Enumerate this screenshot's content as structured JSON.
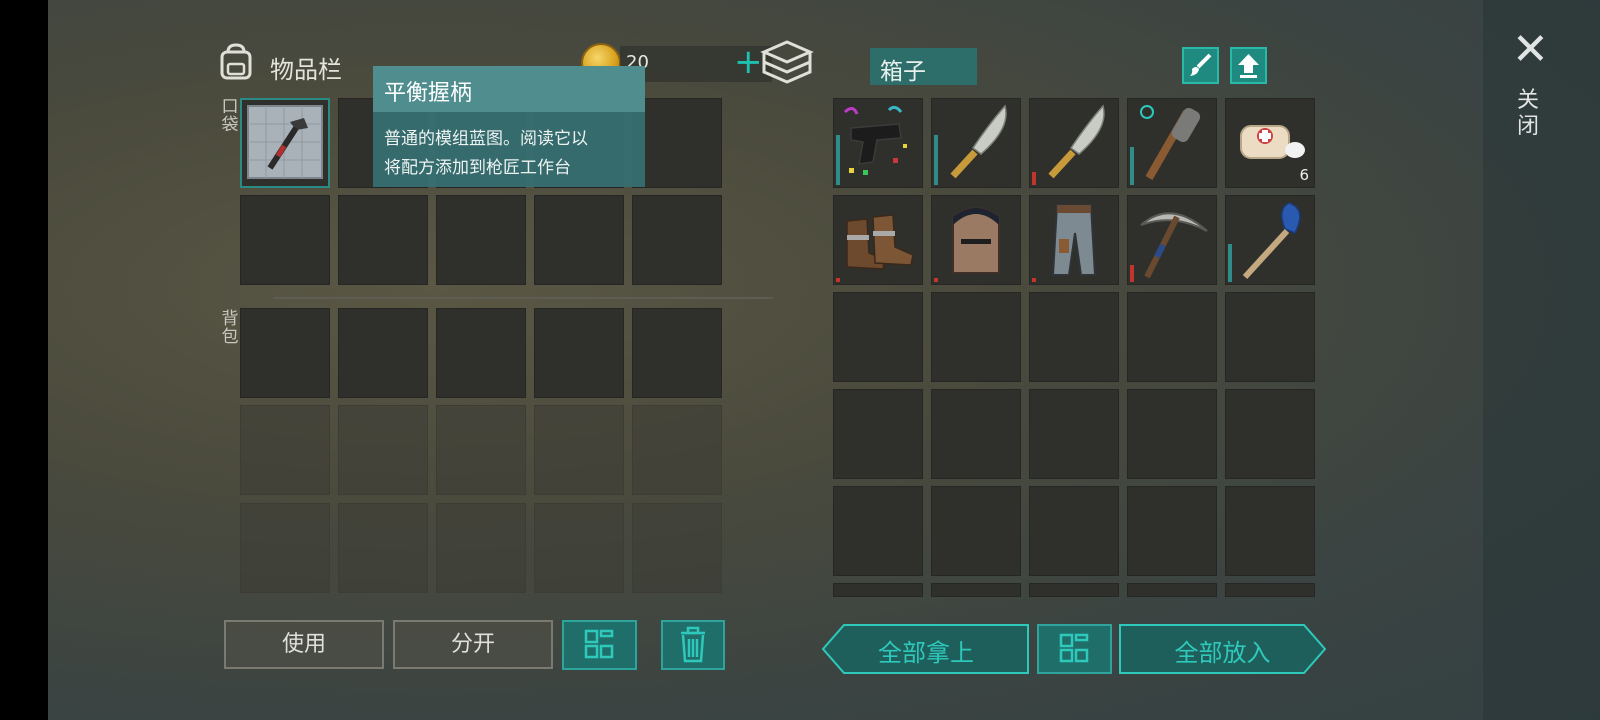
{
  "inventory": {
    "title": "物品栏",
    "currency_amount": "20",
    "add_currency_icon": "plus-icon",
    "pocket_label": "口袋",
    "backpack_label": "背包",
    "pocket_items": [
      {
        "name": "balanced-grip-blueprint",
        "icon": "blueprint-hammer-icon",
        "selected": true
      }
    ]
  },
  "tooltip": {
    "title": "平衡握柄",
    "description_line1": "普通的模组蓝图。阅读它以",
    "description_line2": "将配方添加到枪匠工作台"
  },
  "actions": {
    "use_label": "使用",
    "split_label": "分开"
  },
  "chest": {
    "title": "箱子",
    "items": [
      {
        "icon": "pistol-icon",
        "durability": 0.6,
        "bar_color": "#2f8c88"
      },
      {
        "icon": "machete-icon",
        "durability": 0.6,
        "bar_color": "#2f8c88"
      },
      {
        "icon": "machete-icon",
        "durability": 0.15,
        "bar_color": "#c0352c"
      },
      {
        "icon": "spiked-club-icon",
        "durability": 0.45,
        "bar_color": "#2f8c88"
      },
      {
        "icon": "bandage-icon",
        "count": "6"
      },
      {
        "icon": "boots-icon",
        "durability": 0.05,
        "bar_color": "#c0352c"
      },
      {
        "icon": "helmet-icon",
        "durability": 0.05,
        "bar_color": "#c0352c"
      },
      {
        "icon": "pants-icon",
        "durability": 0.05,
        "bar_color": "#c0352c"
      },
      {
        "icon": "pickaxe-icon",
        "durability": 0.2,
        "bar_color": "#c0352c"
      },
      {
        "icon": "paddle-icon",
        "durability": 0.45,
        "bar_color": "#2f8c88"
      }
    ],
    "take_all_label": "全部拿上",
    "put_all_label": "全部放入"
  },
  "close_label": "关闭",
  "colors": {
    "accent": "#2ec9bb",
    "danger": "#c0352c",
    "tooltip_bg": "#367072"
  }
}
